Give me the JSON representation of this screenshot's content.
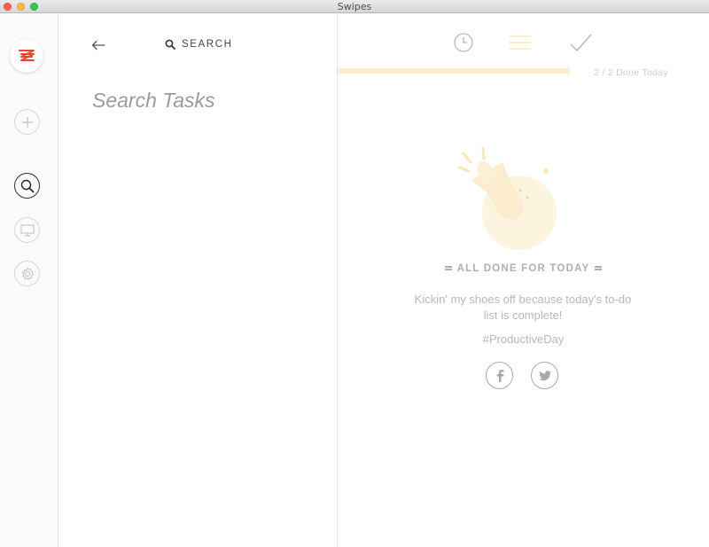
{
  "window": {
    "title": "Swipes"
  },
  "rail": {
    "logo_icon": "swipes-logo-icon",
    "brand_color": "#e8492d",
    "items": [
      {
        "name": "add",
        "icon": "plus-icon"
      },
      {
        "name": "search",
        "icon": "search-icon",
        "active": true
      },
      {
        "name": "workspace",
        "icon": "monitor-icon"
      },
      {
        "name": "settings",
        "icon": "gear-icon"
      }
    ]
  },
  "search_panel": {
    "header_label": "SEARCH",
    "input_placeholder": "Search Tasks",
    "input_value": ""
  },
  "main": {
    "tabs": [
      {
        "name": "schedule",
        "icon": "clock-icon"
      },
      {
        "name": "now",
        "icon": "list-icon",
        "active": true,
        "color": "#f5c842"
      },
      {
        "name": "done",
        "icon": "checkmark-icon"
      }
    ],
    "progress": {
      "label": "2 / 2 Done Today",
      "fraction": 1.0,
      "color": "#f5d77a"
    },
    "empty_state": {
      "heading": "ALL DONE FOR TODAY",
      "text": "Kickin' my shoes off because today's to-do list is complete!",
      "hashtag": "#ProductiveDay",
      "share": [
        {
          "name": "facebook",
          "icon": "facebook-icon"
        },
        {
          "name": "twitter",
          "icon": "twitter-icon"
        }
      ]
    }
  }
}
